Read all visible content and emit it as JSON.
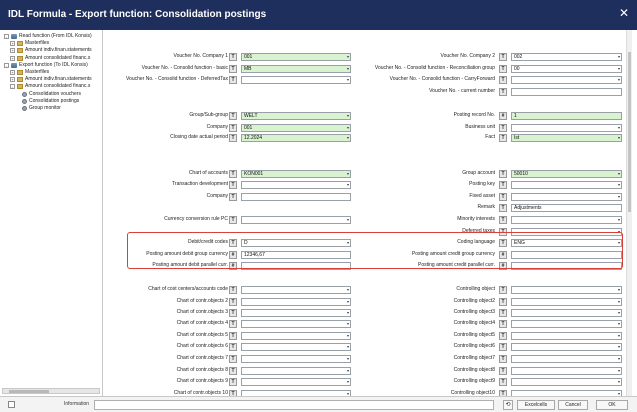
{
  "window": {
    "title": "IDL Formula - Export function: Consolidation postings",
    "close_glyph": "✕"
  },
  "tree": [
    {
      "label": "Read function (From IDL Konsis)",
      "exp": "-",
      "icon": "db"
    },
    {
      "label": "Masterfiles",
      "exp": "+",
      "icon": "folder"
    },
    {
      "label": "Amount indiv.finan.statements",
      "exp": "+",
      "icon": "folder"
    },
    {
      "label": "Amount consolidated financ.s",
      "exp": "+",
      "icon": "folder"
    },
    {
      "label": "Export function (To IDL Konsis)",
      "exp": "-",
      "icon": "db"
    },
    {
      "label": "Masterfiles",
      "exp": "+",
      "icon": "folder"
    },
    {
      "label": "Amount indiv.finan.statements",
      "exp": "+",
      "icon": "folder"
    },
    {
      "label": "Amount consolidated financ.s",
      "exp": "-",
      "icon": "folder"
    },
    {
      "label": "Consolidation vouchers",
      "exp": "",
      "icon": "gear"
    },
    {
      "label": "Consolidation postings",
      "exp": "",
      "icon": "gear"
    },
    {
      "label": "Group monitor",
      "exp": "",
      "icon": "gear"
    }
  ],
  "form": {
    "left": [
      {
        "label": "Voucher No. Company 1",
        "btn": "T",
        "value": "001",
        "green": true,
        "dd": true
      },
      {
        "label": "Voucher No. - Consolid function - basic",
        "btn": "T",
        "value": "MB",
        "green": true,
        "dd": true
      },
      {
        "label": "Voucher No. - Consolid function - DeferredTax",
        "btn": "T",
        "value": "",
        "green": false,
        "dd": true
      },
      {
        "label": "Group/Sub-group",
        "btn": "T",
        "value": "WELT",
        "green": true,
        "dd": true
      },
      {
        "label": "Company",
        "btn": "T",
        "value": "001",
        "green": true,
        "dd": true
      },
      {
        "label": "Closing date actual period",
        "btn": "T",
        "value": "12.2024",
        "green": true,
        "dd": true
      },
      {
        "label": "Chart of accounts",
        "btn": "T",
        "value": "KON001",
        "green": true,
        "dd": true
      },
      {
        "label": "Transaction development",
        "btn": "T",
        "value": "",
        "green": false,
        "dd": true
      },
      {
        "label": "Company",
        "btn": "T",
        "value": "",
        "green": false,
        "dd": false
      },
      {
        "label": "Currency conversion rule PC",
        "btn": "T",
        "value": "",
        "green": false,
        "dd": true
      },
      {
        "label": "Debit/credit codes",
        "btn": "T",
        "value": "D",
        "green": false,
        "dd": true
      },
      {
        "label": "Posting amount debit group currency",
        "btn": "#",
        "value": "12346,67",
        "green": false,
        "dd": false
      },
      {
        "label": "Posting amount debit parallel curr.",
        "btn": "#",
        "value": "",
        "green": false,
        "dd": false
      },
      {
        "label": "Chart of cost centers/accounts code",
        "btn": "T",
        "value": "",
        "green": false,
        "dd": true
      },
      {
        "label": "Chart of contr.objects 2",
        "btn": "T",
        "value": "",
        "green": false,
        "dd": true
      },
      {
        "label": "Chart of contr.objects 3",
        "btn": "T",
        "value": "",
        "green": false,
        "dd": true
      },
      {
        "label": "Chart of contr.objects 4",
        "btn": "T",
        "value": "",
        "green": false,
        "dd": true
      },
      {
        "label": "Chart of contr.objects 5",
        "btn": "T",
        "value": "",
        "green": false,
        "dd": true
      },
      {
        "label": "Chart of contr.objects 6",
        "btn": "T",
        "value": "",
        "green": false,
        "dd": true
      },
      {
        "label": "Chart of contr.objects 7",
        "btn": "T",
        "value": "",
        "green": false,
        "dd": true
      },
      {
        "label": "Chart of contr.objects 8",
        "btn": "T",
        "value": "",
        "green": false,
        "dd": true
      },
      {
        "label": "Chart of contr.objects 9",
        "btn": "T",
        "value": "",
        "green": false,
        "dd": true
      },
      {
        "label": "Chart of contr.objects 10",
        "btn": "T",
        "value": "",
        "green": false,
        "dd": true
      }
    ],
    "right": [
      {
        "label": "Voucher No. Company 2",
        "btn": "T",
        "value": "002",
        "green": false,
        "dd": true
      },
      {
        "label": "Voucher No. - Consolid function - Reconciliation group",
        "btn": "T",
        "value": "00",
        "green": false,
        "dd": true
      },
      {
        "label": "Voucher No. - Consolid function - CarryForward",
        "btn": "T",
        "value": "",
        "green": false,
        "dd": true
      },
      {
        "label": "Voucher No. - current number",
        "btn": "T",
        "value": "",
        "green": false,
        "dd": false
      },
      {
        "label": "Posting record No.",
        "btn": "#",
        "value": "1",
        "green": true,
        "dd": false
      },
      {
        "label": "Business unit",
        "btn": "T",
        "value": "",
        "green": false,
        "dd": true
      },
      {
        "label": "Fact",
        "btn": "T",
        "value": "Ist",
        "green": true,
        "dd": true
      },
      {
        "label": "Group account",
        "btn": "T",
        "value": "50010",
        "green": true,
        "dd": true
      },
      {
        "label": "Posting key",
        "btn": "T",
        "value": "",
        "green": false,
        "dd": true
      },
      {
        "label": "Fixed asset",
        "btn": "T",
        "value": "",
        "green": false,
        "dd": true
      },
      {
        "label": "Remark",
        "btn": "T",
        "value": "Adjustments",
        "green": false,
        "dd": false
      },
      {
        "label": "Minority interests",
        "btn": "T",
        "value": "",
        "green": false,
        "dd": true
      },
      {
        "label": "Deferred taxes",
        "btn": "T",
        "value": "",
        "green": false,
        "dd": true
      },
      {
        "label": "Coding language",
        "btn": "T",
        "value": "ENG",
        "green": false,
        "dd": true
      },
      {
        "label": "Posting amount credit group currency",
        "btn": "#",
        "value": "",
        "green": false,
        "dd": false
      },
      {
        "label": "Posting amount credit parallel curr.",
        "btn": "#",
        "value": "",
        "green": false,
        "dd": false
      },
      {
        "label": "Controlling object",
        "btn": "T",
        "value": "",
        "green": false,
        "dd": true
      },
      {
        "label": "Controlling object2",
        "btn": "T",
        "value": "",
        "green": false,
        "dd": true
      },
      {
        "label": "Controlling object3",
        "btn": "T",
        "value": "",
        "green": false,
        "dd": true
      },
      {
        "label": "Controlling object4",
        "btn": "T",
        "value": "",
        "green": false,
        "dd": true
      },
      {
        "label": "Controlling object5",
        "btn": "T",
        "value": "",
        "green": false,
        "dd": true
      },
      {
        "label": "Controlling object6",
        "btn": "T",
        "value": "",
        "green": false,
        "dd": true
      },
      {
        "label": "Controlling object7",
        "btn": "T",
        "value": "",
        "green": false,
        "dd": true
      },
      {
        "label": "Controlling object8",
        "btn": "T",
        "value": "",
        "green": false,
        "dd": true
      },
      {
        "label": "Controlling object9",
        "btn": "T",
        "value": "",
        "green": false,
        "dd": true
      },
      {
        "label": "Controlling object10",
        "btn": "T",
        "value": "",
        "green": false,
        "dd": true
      }
    ]
  },
  "footer": {
    "info_label": "Information",
    "excelcells": "Excelcells",
    "cancel": "Cancel",
    "ok": "OK"
  },
  "colors": {
    "titlebar": "#1e2f5e",
    "field_green": "#d9f2cf",
    "highlight": "#d9403a"
  }
}
